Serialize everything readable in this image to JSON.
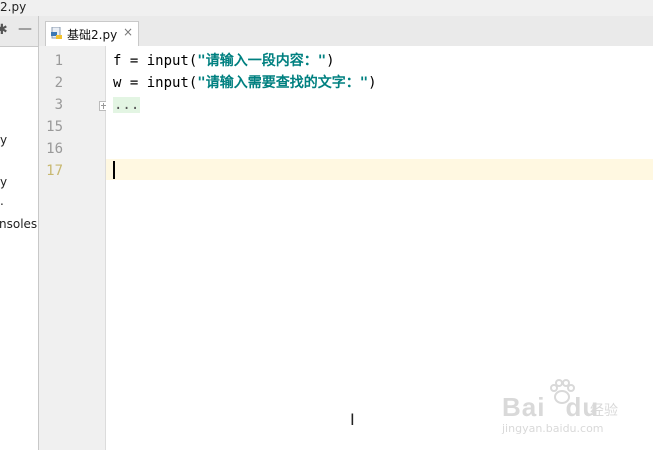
{
  "window": {
    "title_fragment": "2.py"
  },
  "sidebar": {
    "items": [
      "y",
      "y",
      ".",
      "nsoles"
    ]
  },
  "tabs": [
    {
      "label": "基础2.py",
      "icon": "python-file-icon",
      "close": "×"
    }
  ],
  "editor": {
    "lines": [
      {
        "number": "1",
        "prefix": "f = input(",
        "string": "\"请输入一段内容：\"",
        "suffix": ")"
      },
      {
        "number": "2",
        "prefix": "w = input(",
        "string": "\"请输入需要查找的文字：\"",
        "suffix": ")"
      },
      {
        "number": "3",
        "folded": "..."
      },
      {
        "number": "15"
      },
      {
        "number": "16"
      },
      {
        "number": "17",
        "current": true
      }
    ],
    "current_line_color": "#fff8e1",
    "string_color": "#008080"
  },
  "watermark": {
    "logo": "Bai",
    "logo_tail": "du",
    "jingyan": "经验",
    "url": "jingyan.baidu.com"
  }
}
